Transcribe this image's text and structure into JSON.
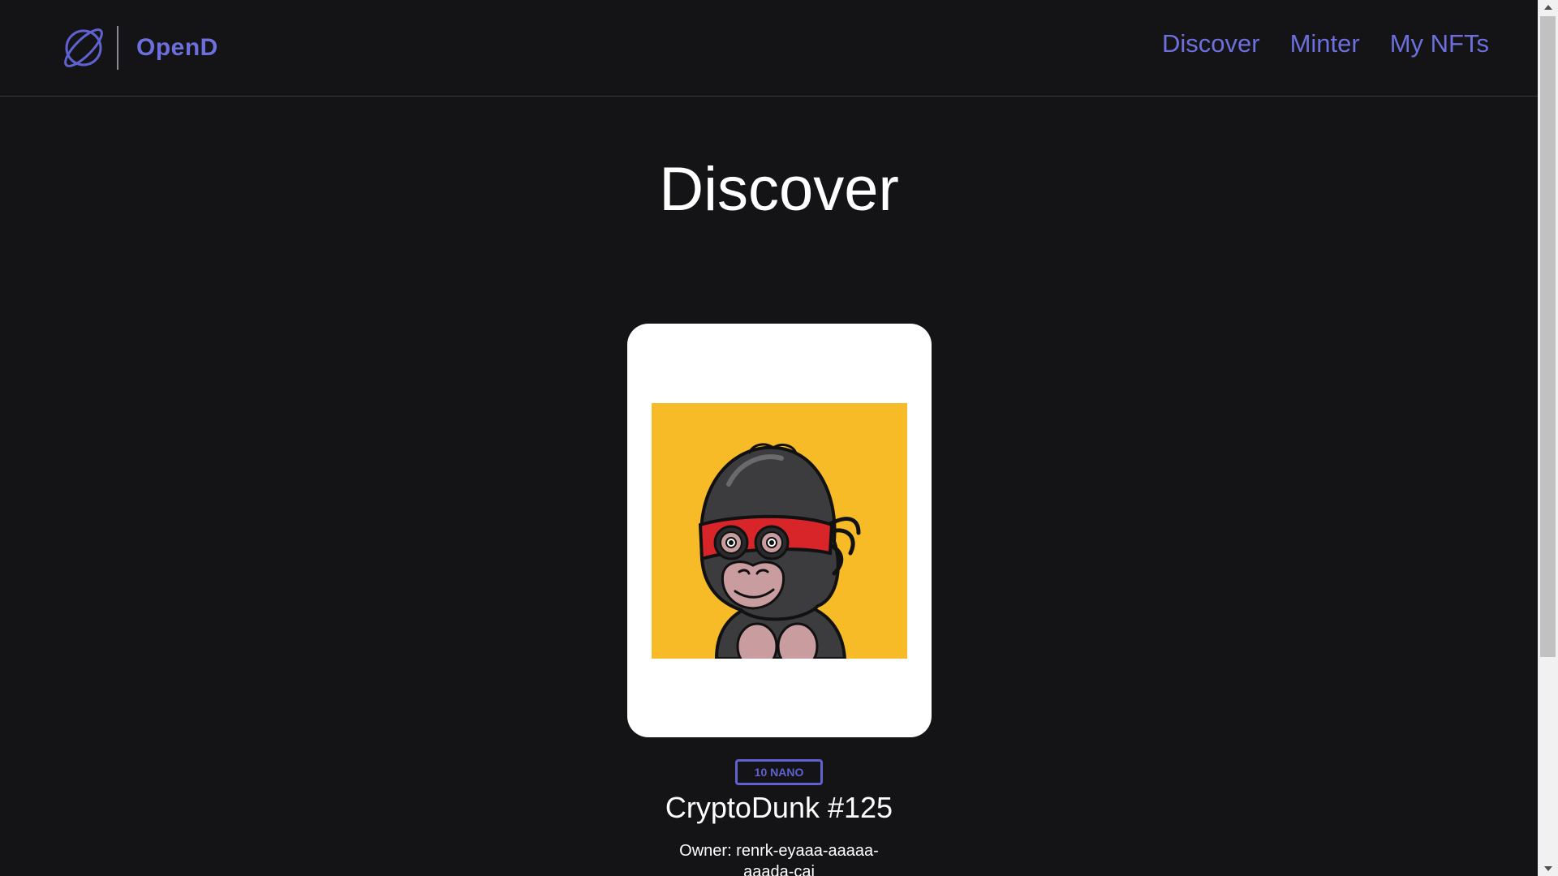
{
  "header": {
    "brand": "OpenD",
    "logo_icon": "planet-icon",
    "nav": [
      "Discover",
      "Minter",
      "My NFTs"
    ]
  },
  "page": {
    "title": "Discover"
  },
  "nft": {
    "image_icon": "masked-gorilla-nft-image",
    "price": "10 NANO",
    "name": "CryptoDunk #125",
    "owner": "Owner: renrk-eyaaa-aaaaa-aaada-cai"
  },
  "colors": {
    "background": "#141416",
    "accent": "#6c6fdc",
    "card": "#ffffff",
    "nft_background": "#f7bb28"
  }
}
